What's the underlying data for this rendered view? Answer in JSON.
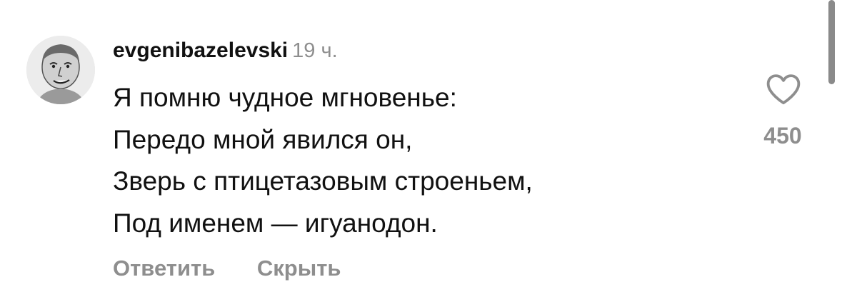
{
  "comment": {
    "username": "evgenibazelevski",
    "timestamp": "19 ч.",
    "lines": [
      "Я помню чудное мгновенье:",
      "Передо мной явился он,",
      "Зверь с птицетазовым строеньем,",
      "Под именем — игуанодон."
    ],
    "likes": "450",
    "reply_label": "Ответить",
    "hide_label": "Скрыть"
  },
  "icons": {
    "like": "heart-outline-icon",
    "avatar": "user-avatar"
  },
  "colors": {
    "text": "#111111",
    "muted": "#8e8e8e",
    "background": "#ffffff"
  }
}
